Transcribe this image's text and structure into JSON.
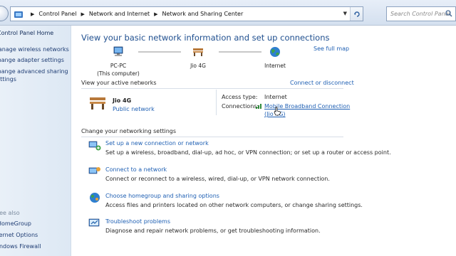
{
  "breadcrumb": [
    "Control Panel",
    "Network and Internet",
    "Network and Sharing Center"
  ],
  "search": {
    "placeholder": "Search Control Panel"
  },
  "left_panel": {
    "home": "Control Panel Home",
    "links": [
      "Manage wireless networks",
      "Change adapter settings",
      "Change advanced sharing",
      "settings"
    ],
    "see_also": "See also",
    "see_also_links": [
      "HomeGroup",
      "Internet Options",
      "Windows Firewall"
    ]
  },
  "main": {
    "title": "View your basic network information and set up connections",
    "see_full_map": "See full map",
    "map": {
      "pc": {
        "name": "PC-PC",
        "sub": "(This computer)"
      },
      "network": {
        "name": "Jio 4G"
      },
      "internet": {
        "name": "Internet"
      }
    },
    "active_networks_label": "View your active networks",
    "connect_disconnect": "Connect or disconnect",
    "active_network": {
      "name": "Jio 4G",
      "type": "Public network",
      "access_type_label": "Access type:",
      "access_type_value": "Internet",
      "connections_label": "Connections:",
      "connection_line1": "Mobile Broadband Connection",
      "connection_line2": "(Jio 4G)"
    },
    "change_settings_label": "Change your networking settings",
    "tasks": [
      {
        "title": "Set up a new connection or network",
        "desc": "Set up a wireless, broadband, dial-up, ad hoc, or VPN connection; or set up a router or access point."
      },
      {
        "title": "Connect to a network",
        "desc": "Connect or reconnect to a wireless, wired, dial-up, or VPN network connection."
      },
      {
        "title": "Choose homegroup and sharing options",
        "desc": "Access files and printers located on other network computers, or change sharing settings."
      },
      {
        "title": "Troubleshoot problems",
        "desc": "Diagnose and repair network problems, or get troubleshooting information."
      }
    ]
  },
  "colors": {
    "link": "#1e5fb3",
    "title": "#1f4f8f",
    "sidebar_bg": "#e3ecf6"
  },
  "icons": [
    "back-icon",
    "control-panel-icon",
    "chevron-right-icon",
    "refresh-icon",
    "search-icon",
    "computer-icon",
    "bench-icon",
    "globe-icon",
    "signal-icon",
    "mouse-pointer-icon"
  ]
}
